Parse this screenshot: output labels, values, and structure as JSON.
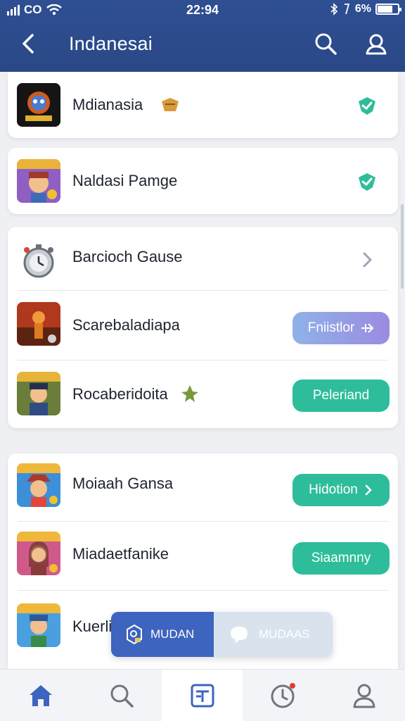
{
  "status_bar": {
    "carrier": "CO",
    "time": "22:94",
    "battery": "6%"
  },
  "header": {
    "title": "Indanesai"
  },
  "list": [
    {
      "label": "Mdianasia",
      "action": "check"
    },
    {
      "label": "Naldasi Pamge",
      "action": "check"
    },
    {
      "label": "Barcioch Gause",
      "action": "chevron"
    },
    {
      "label": "Scarebaladiapa",
      "action": "button",
      "button_label": "Fniistlor",
      "button_color": "#9c8be0"
    },
    {
      "label": "Rocaberidoita",
      "action": "button",
      "button_label": "Peleriand",
      "button_color": "#2ebd9a"
    },
    {
      "label": "Moiaah Gansa",
      "action": "button",
      "button_label": "Hidotion",
      "button_color": "#2ebd9a"
    },
    {
      "label": "Miadaetfanike",
      "action": "button",
      "button_label": "Siaamnny",
      "button_color": "#2ebd9a"
    },
    {
      "label": "Kuerli",
      "action": "none"
    }
  ],
  "segmented": {
    "left_label": "MUDAN",
    "right_label": "MUDAAS"
  },
  "bottom_nav": [
    {
      "name": "home-icon",
      "active": false
    },
    {
      "name": "search-icon",
      "active": false
    },
    {
      "name": "board-icon",
      "active": true
    },
    {
      "name": "clock-icon",
      "active": false,
      "badge": true
    },
    {
      "name": "profile-icon",
      "active": false
    }
  ],
  "colors": {
    "header": "#2f4f93",
    "accent_teal": "#2ebd9a",
    "accent_purple": "#9c8be0",
    "nav_active": "#3d64be"
  }
}
